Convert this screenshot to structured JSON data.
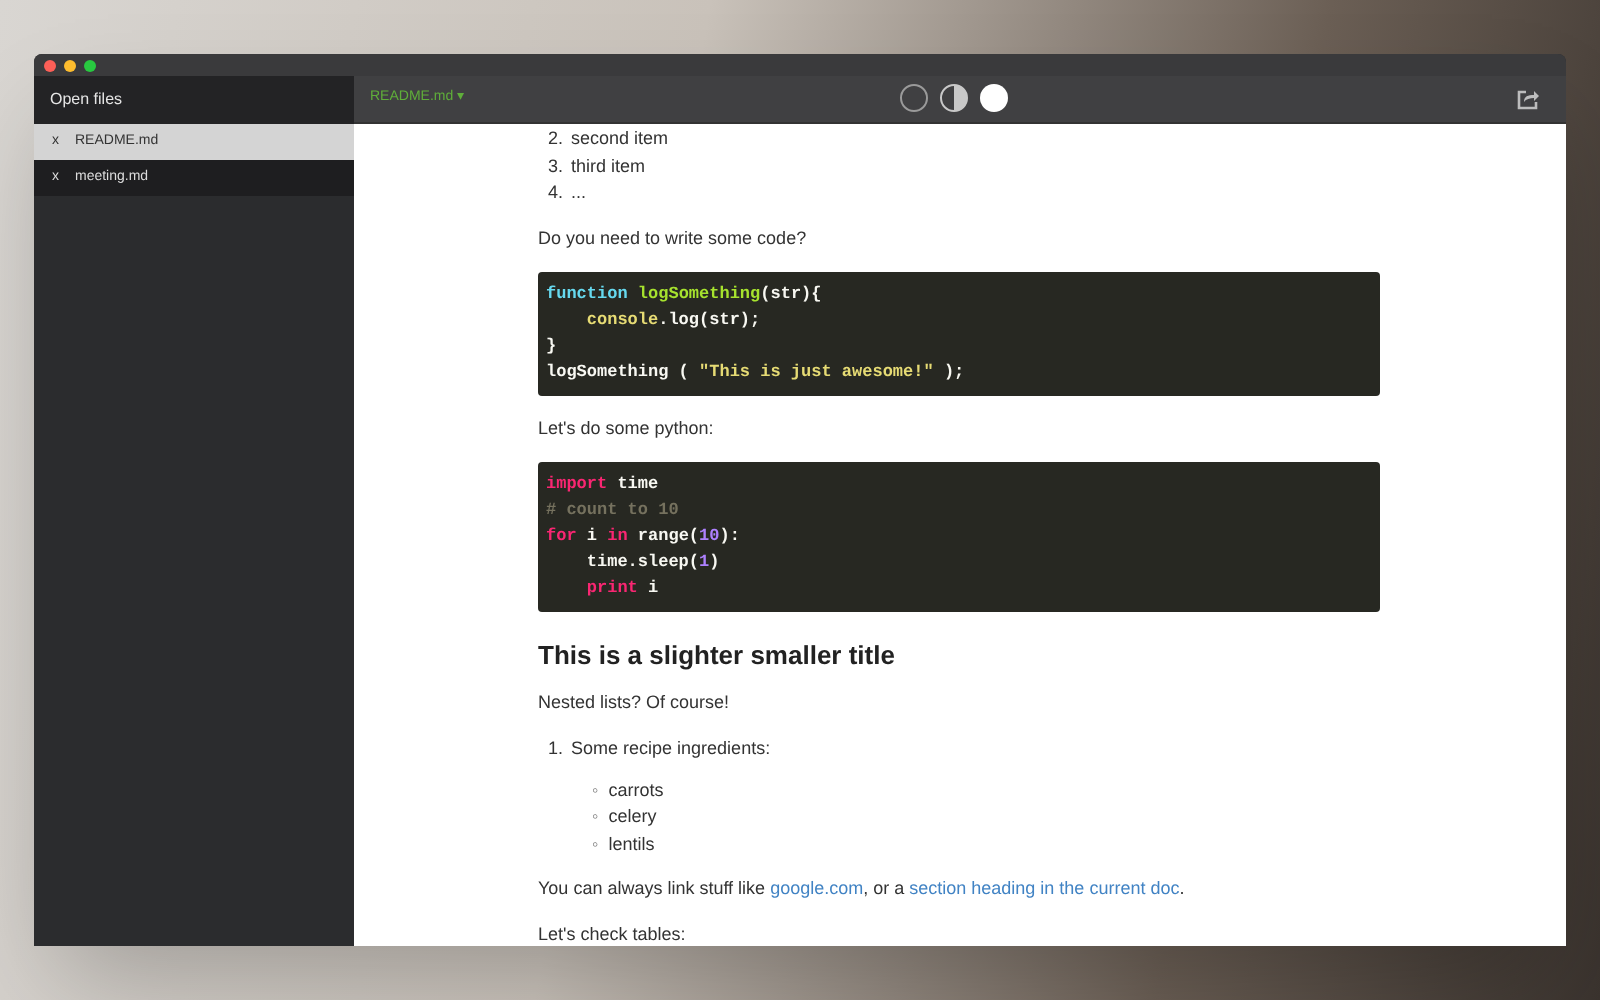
{
  "sidebar": {
    "title": "Open files",
    "files": [
      {
        "close": "x",
        "name": "README.md",
        "selected": true
      },
      {
        "close": "x",
        "name": "meeting.md",
        "selected": false
      }
    ]
  },
  "toolbar": {
    "file_menu": "README.md ▾",
    "themes": [
      {
        "kind": "outline"
      },
      {
        "kind": "half"
      },
      {
        "kind": "filled"
      }
    ]
  },
  "document": [
    {
      "kind": "ordered_list",
      "items": [
        {
          "number": "2.",
          "text": "second item"
        },
        {
          "number": "3.",
          "text": "third item"
        },
        {
          "number": "4.",
          "text": "..."
        }
      ]
    },
    {
      "kind": "paragraph",
      "parts": [
        {
          "kind": "text",
          "text": "Do you need to write some code?"
        }
      ]
    },
    {
      "kind": "code",
      "lines": [
        {
          "indent": false,
          "tokens": [
            {
              "kind": "keyword",
              "text": "function "
            },
            {
              "kind": "name",
              "text": "logSomething"
            },
            {
              "kind": "plain",
              "text": "(str){"
            }
          ]
        },
        {
          "indent": true,
          "tokens": [
            {
              "kind": "builtin",
              "text": "console"
            },
            {
              "kind": "plain",
              "text": ".log(str);"
            }
          ]
        },
        {
          "indent": false,
          "tokens": [
            {
              "kind": "plain",
              "text": "}"
            }
          ]
        },
        {
          "indent": false,
          "tokens": [
            {
              "kind": "plain",
              "text": "logSomething ( "
            },
            {
              "kind": "string",
              "text": "\"This is just awesome!\""
            },
            {
              "kind": "plain",
              "text": " );"
            }
          ]
        }
      ]
    },
    {
      "kind": "paragraph",
      "parts": [
        {
          "kind": "text",
          "text": "Let's do some python:"
        }
      ]
    },
    {
      "kind": "code",
      "lines": [
        {
          "indent": false,
          "tokens": [
            {
              "kind": "control",
              "text": "import"
            },
            {
              "kind": "plain",
              "text": " time"
            }
          ]
        },
        {
          "indent": false,
          "tokens": [
            {
              "kind": "comment",
              "text": "# count to 10"
            }
          ]
        },
        {
          "indent": false,
          "tokens": [
            {
              "kind": "control",
              "text": "for"
            },
            {
              "kind": "plain",
              "text": " i "
            },
            {
              "kind": "control",
              "text": "in"
            },
            {
              "kind": "plain",
              "text": " range("
            },
            {
              "kind": "number",
              "text": "10"
            },
            {
              "kind": "plain",
              "text": "):"
            }
          ]
        },
        {
          "indent": true,
          "tokens": [
            {
              "kind": "plain",
              "text": "time.sleep("
            },
            {
              "kind": "number",
              "text": "1"
            },
            {
              "kind": "plain",
              "text": ")"
            }
          ]
        },
        {
          "indent": true,
          "tokens": [
            {
              "kind": "control",
              "text": "print"
            },
            {
              "kind": "plain",
              "text": " i"
            }
          ]
        }
      ]
    },
    {
      "kind": "heading",
      "text": "This is a slighter smaller title"
    },
    {
      "kind": "paragraph",
      "parts": [
        {
          "kind": "text",
          "text": "Nested lists? Of course!"
        }
      ]
    },
    {
      "kind": "nested_list",
      "number": "1.",
      "text": "Some recipe ingredients:",
      "bullet": "◦",
      "items": [
        "carrots",
        "celery",
        "lentils"
      ]
    },
    {
      "kind": "paragraph",
      "parts": [
        {
          "kind": "text",
          "text": "You can always link stuff like "
        },
        {
          "kind": "link",
          "text": "google.com"
        },
        {
          "kind": "text",
          "text": ", or a "
        },
        {
          "kind": "link",
          "text": "section heading in the current doc"
        },
        {
          "kind": "text",
          "text": "."
        }
      ]
    },
    {
      "kind": "paragraph",
      "parts": [
        {
          "kind": "text",
          "text": "Let's check tables:"
        }
      ]
    }
  ]
}
